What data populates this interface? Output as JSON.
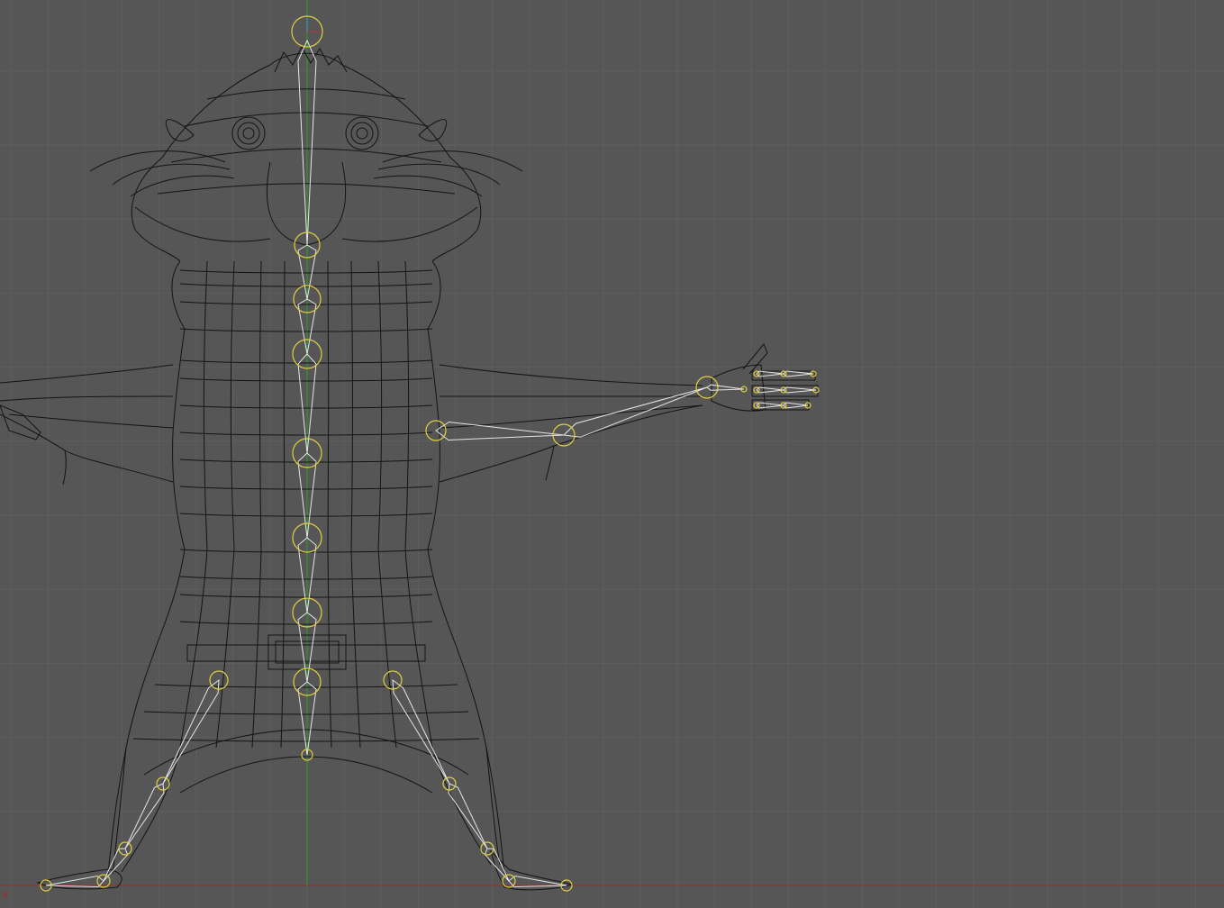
{
  "viewport": {
    "mode": "wireframe",
    "view": "front-orthographic",
    "background_color": "#565656",
    "grid_minor_color": "#5e5e5e",
    "grid_major_color": "#6a6a6a",
    "x_axis_color": "#b02424",
    "z_axis_color": "#2aa02a",
    "axis_label": "x"
  },
  "scene": {
    "mesh": {
      "name_icon": "hamster-character-mesh",
      "wire_color": "#141414"
    },
    "armature": {
      "bone_color": "#e6e6e6",
      "joint_color": "#e0d040",
      "spine_bones": 8,
      "arm_bones": 2,
      "finger_bones": 3,
      "leg_bones": 4
    }
  }
}
